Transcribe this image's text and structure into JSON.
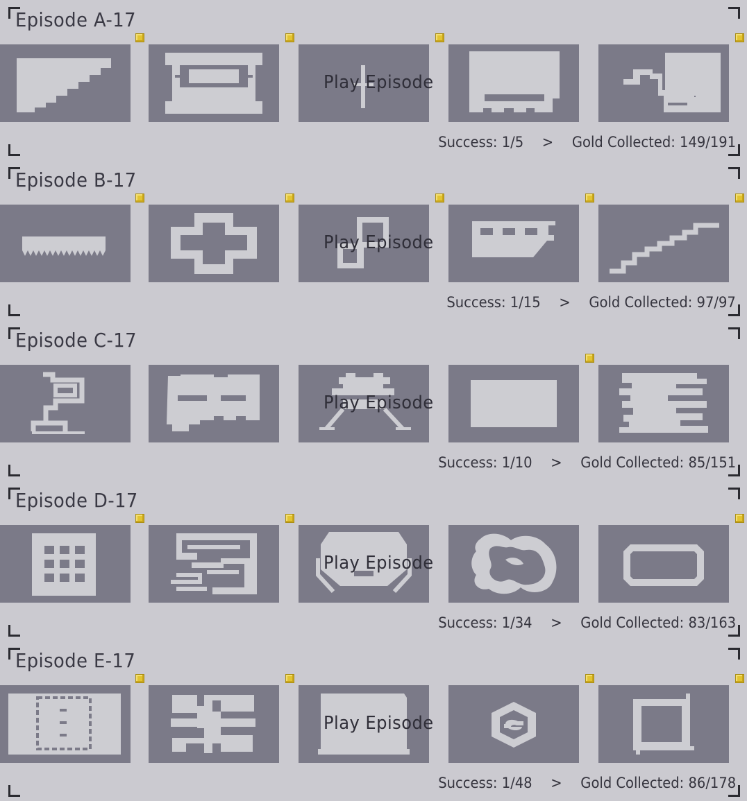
{
  "play_label": "Play Episode",
  "success_label": "Success:",
  "gold_label": "Gold Collected:",
  "separator": ">",
  "colors": {
    "background": "#cbcad0",
    "thumbnail": "#7b7a88",
    "shape": "#cdcdd2",
    "gold": "#e3c431"
  },
  "episodes": [
    {
      "title": "Episode A-17",
      "success": "1/5",
      "gold": "149/191",
      "gold_markers": [
        true,
        true,
        true,
        false,
        true
      ],
      "levels": [
        "staircase-slope",
        "tunnel-frame",
        "vertical-bar",
        "bucket-floor",
        "zigzag-pipe"
      ]
    },
    {
      "title": "Episode B-17",
      "success": "1/15",
      "gold": "97/97",
      "gold_markers": [
        true,
        true,
        true,
        true,
        true
      ],
      "levels": [
        "saw-strip",
        "cross-shape",
        "loop-pipe",
        "bus-block",
        "rising-stairs"
      ]
    },
    {
      "title": "Episode C-17",
      "success": "1/10",
      "gold": "85/151",
      "gold_markers": [
        false,
        false,
        false,
        true,
        false
      ],
      "levels": [
        "tower-branch",
        "brick-cluster",
        "roof-tower",
        "plain-rectangle",
        "stacked-tiers"
      ]
    },
    {
      "title": "Episode D-17",
      "success": "1/34",
      "gold": "83/163",
      "gold_markers": [
        true,
        true,
        false,
        false,
        true
      ],
      "levels": [
        "grid-block",
        "circuit-maze",
        "bowl-arena",
        "cloud-loop",
        "rounded-ring"
      ]
    },
    {
      "title": "Episode E-17",
      "success": "1/48",
      "gold": "86/178",
      "gold_markers": [
        true,
        true,
        false,
        true,
        true
      ],
      "levels": [
        "dotted-frame",
        "branch-network",
        "table-block",
        "hex-emblem",
        "square-frame"
      ]
    }
  ]
}
